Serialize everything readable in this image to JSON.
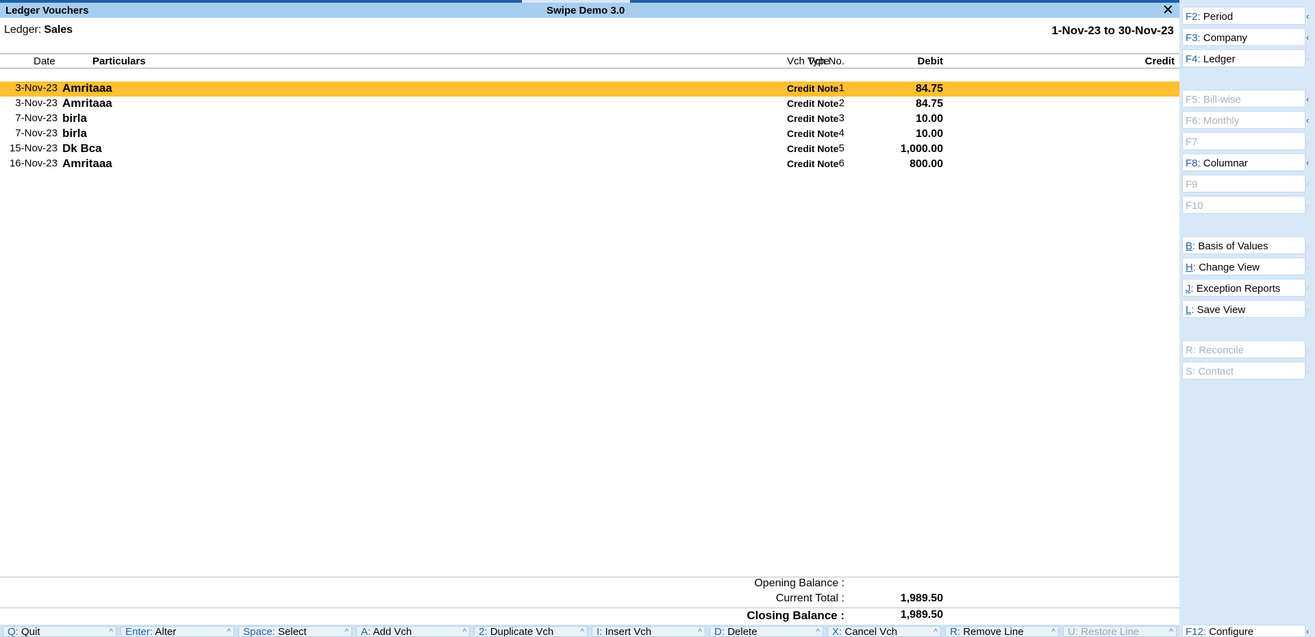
{
  "window": {
    "title": "Ledger Vouchers",
    "company": "Swipe Demo 3.0",
    "close_symbol": "✕"
  },
  "ledger": {
    "label": "Ledger:",
    "name": "Sales",
    "period": "1-Nov-23 to 30-Nov-23"
  },
  "columns": {
    "date": "Date",
    "particulars": "Particulars",
    "vch_type": "Vch Type",
    "vch_no": "Vch No.",
    "debit": "Debit",
    "credit": "Credit"
  },
  "rows": [
    {
      "date": "3-Nov-23",
      "particulars": "Amritaaa",
      "vch_type": "Credit Note",
      "vch_no": "1",
      "debit": "84.75",
      "selected": true
    },
    {
      "date": "3-Nov-23",
      "particulars": "Amritaaa",
      "vch_type": "Credit Note",
      "vch_no": "2",
      "debit": "84.75"
    },
    {
      "date": "7-Nov-23",
      "particulars": "birla",
      "vch_type": "Credit Note",
      "vch_no": "3",
      "debit": "10.00"
    },
    {
      "date": "7-Nov-23",
      "particulars": "birla",
      "vch_type": "Credit Note",
      "vch_no": "4",
      "debit": "10.00"
    },
    {
      "date": "15-Nov-23",
      "particulars": "Dk Bca",
      "vch_type": "Credit Note",
      "vch_no": "5",
      "debit": "1,000.00"
    },
    {
      "date": "16-Nov-23",
      "particulars": "Amritaaa",
      "vch_type": "Credit Note",
      "vch_no": "6",
      "debit": "800.00"
    }
  ],
  "totals": {
    "opening_label": "Opening Balance :",
    "current_label": "Current Total :",
    "current_value": "1,989.50",
    "closing_label": "Closing Balance :",
    "closing_value": "1,989.50"
  },
  "bottom_buttons": [
    {
      "key": "Q",
      "label": "Quit"
    },
    {
      "key": "Enter",
      "label": "Alter"
    },
    {
      "key": "Space",
      "label": "Select"
    },
    {
      "key": "A",
      "label": "Add Vch"
    },
    {
      "key": "2",
      "label": "Duplicate Vch"
    },
    {
      "key": "I",
      "label": "Insert Vch"
    },
    {
      "key": "D",
      "label": "Delete"
    },
    {
      "key": "X",
      "label": "Cancel Vch"
    },
    {
      "key": "R",
      "label": "Remove Line"
    },
    {
      "key": "U",
      "label": "Restore Line"
    }
  ],
  "sidebar": {
    "f2": {
      "key": "F2",
      "label": "Period"
    },
    "f3": {
      "key": "F3",
      "label": "Company"
    },
    "f4": {
      "key": "F4",
      "label": "Ledger"
    },
    "f5": {
      "key": "F5",
      "label": "Bill-wise"
    },
    "f6": {
      "key": "F6",
      "label": "Monthly"
    },
    "f7": {
      "key": "F7",
      "label": ""
    },
    "f8": {
      "key": "F8",
      "label": "Columnar"
    },
    "f9": {
      "key": "F9",
      "label": ""
    },
    "f10": {
      "key": "F10",
      "label": ""
    },
    "b": {
      "key": "B",
      "label": "Basis of Values"
    },
    "h": {
      "key": "H",
      "label": "Change View"
    },
    "j": {
      "key": "J",
      "label": "Exception Reports"
    },
    "l": {
      "key": "L",
      "label": "Save View"
    },
    "r": {
      "key": "R",
      "label": "Reconcile"
    },
    "s": {
      "key": "S",
      "label": "Contact"
    },
    "f12": {
      "key": "F12",
      "label": "Configure"
    }
  },
  "arrow_symbol": "‹",
  "colors": {
    "title_bg": "#a7cdef",
    "selected_row": "#fdc030",
    "sidebar_bg": "#d8e8f6",
    "key_blue": "#1f5fa8"
  }
}
